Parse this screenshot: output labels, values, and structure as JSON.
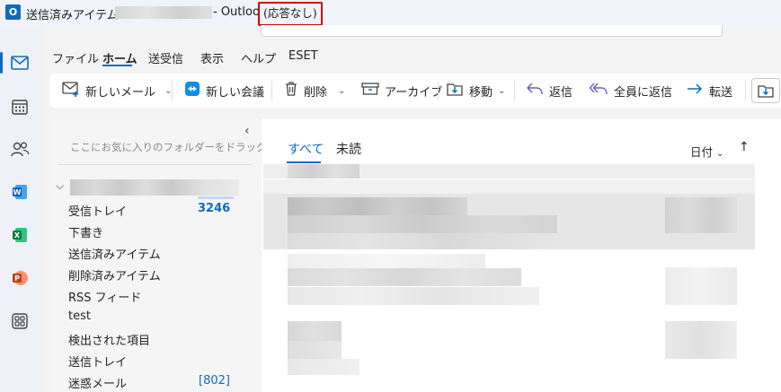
{
  "titlebar": {
    "prefix": "送信済みアイテム -",
    "suffix": "- Outlook",
    "status": "(応答なし)"
  },
  "ribbon": {
    "tabs": [
      "ファイル",
      "ホーム",
      "送受信",
      "表示",
      "ヘルプ",
      "ESET"
    ],
    "active_tab": "ホーム"
  },
  "toolbar": {
    "new_mail": "新しいメール",
    "new_meeting": "新しい会議",
    "delete": "削除",
    "archive": "アーカイブ",
    "move": "移動",
    "reply": "返信",
    "reply_all": "全員に返信",
    "forward": "転送"
  },
  "folder_pane": {
    "favorites_hint": "ここにお気に入りのフォルダーをドラッグします",
    "folders": [
      {
        "name": "受信トレイ",
        "count": "3246"
      },
      {
        "name": "下書き",
        "count": ""
      },
      {
        "name": "送信済みアイテム",
        "count": ""
      },
      {
        "name": "削除済みアイテム",
        "count": ""
      },
      {
        "name": "RSS フィード",
        "count": ""
      },
      {
        "name": "test",
        "count": ""
      },
      {
        "name": "検出された項目",
        "count": ""
      },
      {
        "name": "送信トレイ",
        "count": ""
      },
      {
        "name": "迷惑メール",
        "count": "[802]"
      }
    ]
  },
  "message_list": {
    "tab_all": "すべて",
    "tab_unread": "未読",
    "sort_label": "日付",
    "sort_direction_icon": "arrow-up-icon"
  },
  "colors": {
    "accent": "#0f6cbd",
    "status_border": "#d60000"
  }
}
